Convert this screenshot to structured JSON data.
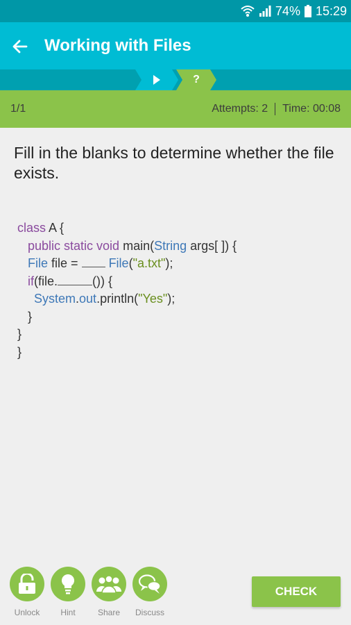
{
  "status_bar": {
    "battery": "74%",
    "time": "15:29"
  },
  "app_bar": {
    "title": "Working with Files"
  },
  "progress": {
    "current": "1/1",
    "attempts": "Attempts: 2",
    "time": "Time: 00:08",
    "step2_label": "?"
  },
  "question": {
    "text": "Fill in the blanks to determine whether the file exists."
  },
  "code": {
    "l1_kw": "class",
    "l1_rest": " A {",
    "l2_kw": "public static void",
    "l2_a": " main(",
    "l2_ty": "String",
    "l2_b": " args[ ]) {",
    "l3_ty1": "File",
    "l3_a": " file = ",
    "l3_ty2": "File",
    "l3_b": "(",
    "l3_str": "\"a.txt\"",
    "l3_c": ");",
    "l4_kw": "if",
    "l4_a": "(file.",
    "l4_b": "()) {",
    "l5_ty": "System",
    "l5_a": ".",
    "l5_out": "out",
    "l5_b": ".println(",
    "l5_str": "\"Yes\"",
    "l5_c": ");",
    "l6": "}",
    "l7": "}",
    "l8": "}"
  },
  "toolbar": {
    "unlock": "Unlock",
    "hint": "Hint",
    "share": "Share",
    "discuss": "Discuss",
    "check": "CHECK"
  },
  "colors": {
    "accent": "#00bcd4",
    "green": "#8bc34a"
  }
}
